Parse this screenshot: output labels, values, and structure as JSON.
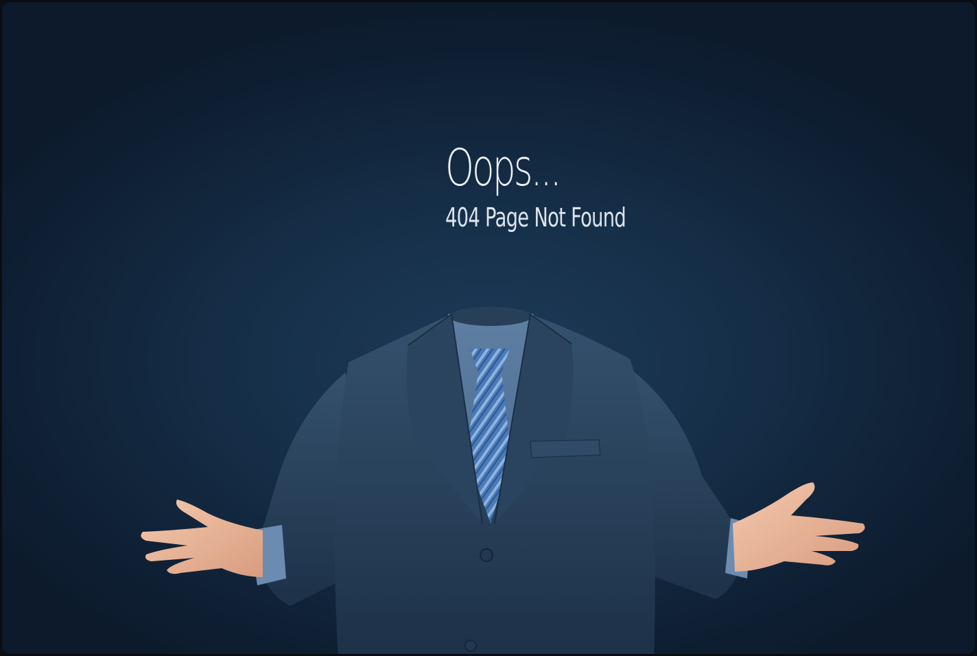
{
  "hero": {
    "headline": "Oops...",
    "message": "404 Page Not Found"
  },
  "illustration": {
    "icon": "headless-businessman-shrugging-icon"
  },
  "colors": {
    "background": "#16304a",
    "text": "#eef2f7",
    "suit": "#2b4660",
    "tie": "#4d7fbf"
  }
}
